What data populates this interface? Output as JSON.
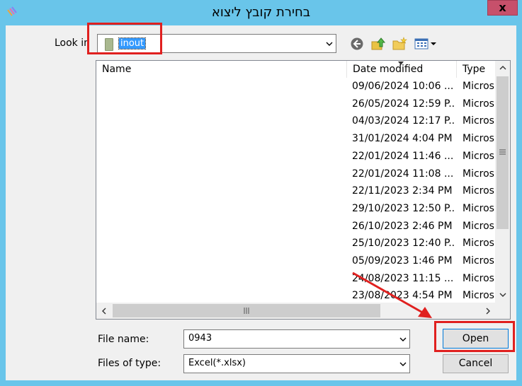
{
  "window": {
    "title": "בחירת קובץ ליצוא",
    "close_glyph": "x"
  },
  "look_in": {
    "label": "Look in",
    "value": "inout"
  },
  "list": {
    "headers": {
      "name": "Name",
      "date": "Date modified",
      "type": "Type"
    },
    "rows": [
      {
        "date": "09/06/2024 10:06 ...",
        "type": "Micros"
      },
      {
        "date": "26/05/2024 12:59 P...",
        "type": "Micros"
      },
      {
        "date": "04/03/2024 12:17 P...",
        "type": "Micros"
      },
      {
        "date": "31/01/2024 4:04 PM",
        "type": "Micros"
      },
      {
        "date": "22/01/2024 11:46 ...",
        "type": "Micros"
      },
      {
        "date": "22/01/2024 11:08 ...",
        "type": "Micros"
      },
      {
        "date": "22/11/2023 2:34 PM",
        "type": "Micros"
      },
      {
        "date": "29/10/2023 12:50 P...",
        "type": "Micros"
      },
      {
        "date": "26/10/2023 2:46 PM",
        "type": "Micros"
      },
      {
        "date": "25/10/2023 12:40 P...",
        "type": "Micros"
      },
      {
        "date": "05/09/2023 1:46 PM",
        "type": "Micros"
      },
      {
        "date": "24/08/2023 11:15 ...",
        "type": "Micros"
      },
      {
        "date": "23/08/2023 4:54 PM",
        "type": "Micros"
      }
    ]
  },
  "file_name": {
    "label": "File name:",
    "value": "0943"
  },
  "file_type": {
    "label": "Files of type:",
    "value": "Excel(*.xlsx)"
  },
  "buttons": {
    "open": "Open",
    "cancel": "Cancel"
  },
  "icons": {
    "app": "app-stripes-icon",
    "back": "back-arrow-icon",
    "up": "up-folder-icon",
    "new_folder": "new-folder-icon",
    "views": "view-menu-icon"
  },
  "colors": {
    "frame": "#69c5ea",
    "highlight": "#e0201f",
    "selection": "#3399ff"
  }
}
